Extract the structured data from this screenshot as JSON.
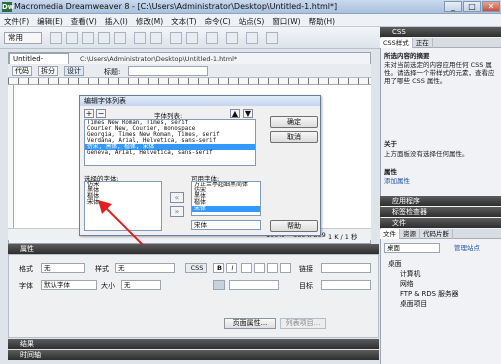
{
  "app": {
    "title": "Macromedia Dreamweaver 8 - [C:\\Users\\Administrator\\Desktop\\Untitled-1.html*]",
    "window_buttons": [
      "_",
      "□",
      "✕"
    ]
  },
  "menubar": [
    "文件(F)",
    "编辑(E)",
    "查看(V)",
    "插入(I)",
    "修改(M)",
    "文本(T)",
    "命令(C)",
    "站点(S)",
    "窗口(W)",
    "帮助(H)"
  ],
  "toolbar": {
    "workspace_label": "常用"
  },
  "document": {
    "tab_label": "Untitled-1.html*",
    "path": "C:\\Users\\Administrator\\Desktop\\Untitled-1.html*",
    "view_code": "代码",
    "view_split": "拆分",
    "view_design": "设计",
    "title_label": "标题:",
    "status": {
      "zoom": "100%",
      "size": "660 x 309",
      "weight": "1 K / 1 秒"
    }
  },
  "dialog": {
    "title": "编辑字体列表",
    "font_list_label": "字体列表:",
    "font_list": [
      "Times New Roman, Times, serif",
      "Courier New, Courier, monospace",
      "Georgia, Times New Roman, Times, serif",
      "Verdana, Arial, Helvetica, sans-serif",
      "仿宋, 黑体, 楷体, 宋体",
      "Geneva, Arial, Helvetica, sans-serif"
    ],
    "selected_font_index": 4,
    "ok_label": "确定",
    "cancel_label": "取消",
    "help_label": "帮助",
    "chosen_label": "选择的字体:",
    "chosen_fonts": [
      "仿宋",
      "黑体",
      "楷体",
      "宋体"
    ],
    "available_label": "可用字体:",
    "available_fonts": [
      "方正兰亭超细黑简体",
      "仿宋",
      "黑体",
      "楷体",
      "宋体"
    ],
    "selected_available_index": 4,
    "available_value": "宋体",
    "move_left": "«",
    "move_right": "»",
    "plus": "+",
    "minus": "−"
  },
  "properties": {
    "header": "属性",
    "format_label": "格式",
    "format_value": "无",
    "style_label": "样式",
    "style_value": "无",
    "css_button": "CSS",
    "bold": "B",
    "italic": "I",
    "link_label": "链接",
    "font_label": "字体",
    "font_value": "默认字体",
    "size_label": "大小",
    "size_value": "无",
    "target_label": "目标",
    "page_props_button": "页面属性...",
    "list_item_button": "列表项目..."
  },
  "results_bar": "结果",
  "timeline_bar": "时间轴",
  "right_panel": {
    "css_header": "CSS",
    "css_tab": "CSS样式",
    "css_tab_current": "正在",
    "all_summary_title": "所选内容的摘要",
    "all_summary_text": "未对当前选定的内容应用任何 CSS 属性。请选择一个带样式的元素，查看应用了哪些 CSS 属性。",
    "about_title": "关于",
    "about_text": "上方面板没有选择任何属性。",
    "props_title": "属性",
    "add_prop": "添加属性",
    "app_header": "应用程序",
    "tag_header": "标签检查器",
    "files_header": "文件",
    "files_tabs": [
      "文件",
      "资源",
      "代码片断"
    ],
    "site_select": "桌面",
    "manage_sites": "管理站点",
    "tree": [
      "桌面",
      "计算机",
      "网络",
      "FTP & RDS 服务器",
      "桌面项目"
    ]
  }
}
